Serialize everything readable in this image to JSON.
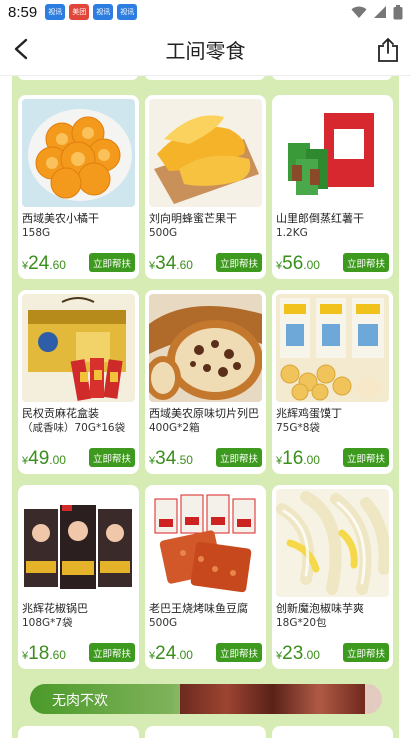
{
  "status_bar": {
    "time": "8:59",
    "notifications": [
      "视讯",
      "美团",
      "视讯",
      "视讯"
    ]
  },
  "nav": {
    "title": "工间零食"
  },
  "products": [
    {
      "name": "西域美农小橘干",
      "spec": "158G",
      "price_int": "24",
      "price_dec": ".60",
      "button": "立即帮扶"
    },
    {
      "name": "刘向明蜂蜜芒果干",
      "spec": "500G",
      "price_int": "34",
      "price_dec": ".60",
      "button": "立即帮扶"
    },
    {
      "name": "山里郎倒蒸红薯干",
      "spec": "1.2KG",
      "price_int": "56",
      "price_dec": ".00",
      "button": "立即帮扶"
    },
    {
      "name": "民权贡麻花盒装",
      "spec": "（咸香味）70G*16袋",
      "price_int": "49",
      "price_dec": ".00",
      "button": "立即帮扶"
    },
    {
      "name": "西域美农原味切片列巴",
      "spec": "400G*2箱",
      "price_int": "34",
      "price_dec": ".50",
      "button": "立即帮扶"
    },
    {
      "name": "兆辉鸡蛋馍丁",
      "spec": "75G*8袋",
      "price_int": "16",
      "price_dec": ".00",
      "button": "立即帮扶"
    },
    {
      "name": "兆辉花椒锅巴",
      "spec": "108G*7袋",
      "price_int": "18",
      "price_dec": ".60",
      "button": "立即帮扶"
    },
    {
      "name": "老巴王烧烤味鱼豆腐",
      "spec": "500G",
      "price_int": "24",
      "price_dec": ".00",
      "button": "立即帮扶"
    },
    {
      "name": "创新魔泡椒味芋爽",
      "spec": "18G*20包",
      "price_int": "23",
      "price_dec": ".00",
      "button": "立即帮扶"
    }
  ],
  "currency": "¥",
  "section": {
    "title": "无肉不欢"
  },
  "colors": {
    "accent": "#3e9a1e",
    "panel": "#d7ecb5",
    "price": "#3b8f1d"
  }
}
